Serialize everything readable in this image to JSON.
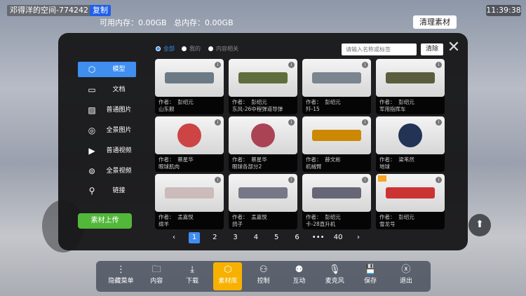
{
  "header": {
    "space_title": "邓得洋的空间-774242",
    "copy_label": "复制",
    "memory": "可用内存：0.00GB   总内存：0.00GB",
    "clock": "11:39:38",
    "clean_label": "清理素材"
  },
  "sidebar": {
    "items": [
      {
        "label": "模型",
        "icon": "cube-icon"
      },
      {
        "label": "文档",
        "icon": "document-icon"
      },
      {
        "label": "普通图片",
        "icon": "image-icon"
      },
      {
        "label": "全景图片",
        "icon": "panorama-360-icon"
      },
      {
        "label": "普通视频",
        "icon": "video-icon"
      },
      {
        "label": "全景视频",
        "icon": "panorama-video-icon"
      },
      {
        "label": "链接",
        "icon": "link-icon"
      }
    ],
    "upload_label": "素材上传"
  },
  "filters": [
    {
      "label": "全部",
      "selected": true
    },
    {
      "label": "我的",
      "selected": false
    },
    {
      "label": "内容相关",
      "selected": false
    }
  ],
  "search": {
    "placeholder": "请输入名称或标签",
    "clear_label": "清除"
  },
  "cards": [
    {
      "author": "作者：  彭绍元",
      "name": "山东舰"
    },
    {
      "author": "作者：  彭绍元",
      "name": "东风-26中程弹道导弹"
    },
    {
      "author": "作者：  彭绍元",
      "name": "歼-15"
    },
    {
      "author": "作者：  彭绍元",
      "name": "军用指挥车"
    },
    {
      "author": "作者：  蔡星华",
      "name": "眼球肌肉"
    },
    {
      "author": "作者：  蔡星华",
      "name": "眼球各部分2"
    },
    {
      "author": "作者：  薛文彬",
      "name": "机械臂"
    },
    {
      "author": "作者：  梁苇然",
      "name": "地球"
    },
    {
      "author": "作者：  孟嘉悦",
      "name": "绵羊"
    },
    {
      "author": "作者：  孟嘉悦",
      "name": "鸽子"
    },
    {
      "author": "作者：  彭绍元",
      "name": "卡-28直升机"
    },
    {
      "author": "作者：  彭绍元",
      "name": "雪龙号"
    }
  ],
  "pagination": {
    "prev": "‹",
    "pages": [
      "1",
      "2",
      "3",
      "4",
      "5",
      "6",
      "•••",
      "40"
    ],
    "current": "1",
    "next": "›"
  },
  "toolbar": [
    {
      "label": "隐藏菜单",
      "icon": "more-icon"
    },
    {
      "label": "内容",
      "icon": "folder-icon"
    },
    {
      "label": "下载",
      "icon": "download-icon"
    },
    {
      "label": "素材库",
      "icon": "cube-icon",
      "active": true
    },
    {
      "label": "控制",
      "icon": "control-icon"
    },
    {
      "label": "互动",
      "icon": "people-icon"
    },
    {
      "label": "麦克风",
      "icon": "microphone-icon"
    },
    {
      "label": "保存",
      "icon": "save-icon"
    },
    {
      "label": "退出",
      "icon": "exit-icon"
    }
  ]
}
